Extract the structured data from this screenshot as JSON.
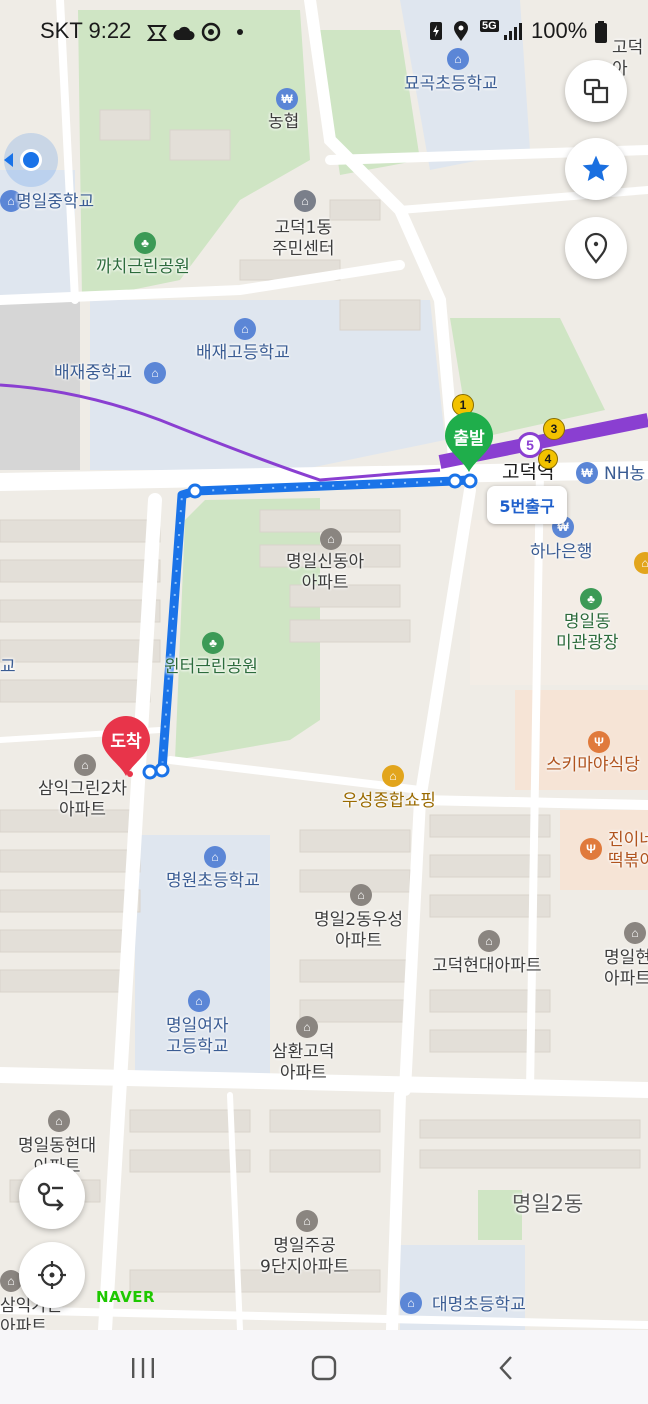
{
  "status_bar": {
    "carrier_time": "SKT 9:22",
    "network": "5G",
    "battery": "100%"
  },
  "map": {
    "labels": {
      "myogok_elem": "묘곡초등학교",
      "nonghyup": "농협",
      "myeongil_middle": "명일중학교",
      "godeok1_center_l1": "고덕1동",
      "godeok1_center_l2": "주민센터",
      "kkachi_park": "까치근린공원",
      "baejae_high": "배재고등학교",
      "baejae_middle": "배재중학교",
      "godeok_station": "고덕역",
      "nh_bank": "NH농",
      "hana_bank": "하나은행",
      "sindonga_l1": "명일신동아",
      "sindonga_l2": "아파트",
      "myeongil_plaza_l1": "명일동",
      "myeongil_plaza_l2": "미관광장",
      "winter_park": "윈터근린공원",
      "samik_apt_l1": "삼익그린2차",
      "samik_apt_l2": "아파트",
      "skimaya": "스키마야식당",
      "woosung_shopping": "우성종합쇼핑",
      "jini_l1": "진이네",
      "jini_l2": "떡볶이",
      "myeongwon_elem": "명원초등학교",
      "woosung_apt_l1": "명일2동우성",
      "woosung_apt_l2": "아파트",
      "godeok_hyundai": "고덕현대아파트",
      "myeongil_hyundai_r_l1": "명일현",
      "myeongil_hyundai_r_l2": "아파트",
      "girls_high_l1": "명일여자",
      "girls_high_l2": "고등학교",
      "samhwan_l1": "삼환고덕",
      "samhwan_l2": "아파트",
      "myeongil_hyundai_l_l1": "명일동현대",
      "myeongil_hyundai_l_l2": "아파트",
      "district": "명일2동",
      "jugong_l1": "명일주공",
      "jugong_l2": "9단지아파트",
      "samik_l_l1": "삼익가든",
      "samik_l_l2": "아파트",
      "daemyeong_elem": "대명초등학교",
      "godeok_r_l1": "고덕",
      "godeok_r_l2": "아",
      "edge_left": "교"
    },
    "route": {
      "start_label": "출발",
      "end_label": "도착",
      "exit_label": "5번출구",
      "line_number": "5",
      "exit_numbers": [
        "1",
        "3",
        "4"
      ]
    },
    "brand": "NAVER"
  },
  "colors": {
    "route": "#1a73e8",
    "subway_line5": "#8a3fd1",
    "start_marker": "#1fae4b",
    "end_marker": "#e8344a",
    "star": "#1a6fe0"
  },
  "icons": [
    "layers-icon",
    "star-icon",
    "location-pin-icon",
    "route-icon",
    "gps-icon",
    "recent-apps-icon",
    "home-icon",
    "back-icon"
  ]
}
